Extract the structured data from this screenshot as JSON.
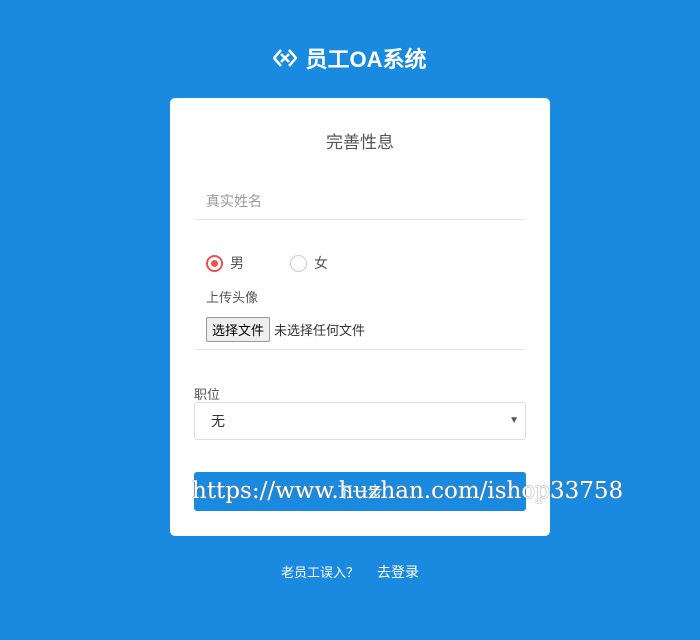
{
  "brand": {
    "title": "员工OA系统",
    "icon": "diamond-links-icon"
  },
  "form": {
    "title": "完善性息",
    "name_placeholder": "真实姓名",
    "gender": {
      "options": [
        "男",
        "女"
      ],
      "selected": "男"
    },
    "avatar_label": "上传头像",
    "file_button": "选择文件",
    "file_status": "未选择任何文件",
    "position_label": "职位",
    "position_value": "无",
    "next_button": "下一步"
  },
  "footer": {
    "prompt": "老员工误入？",
    "login_link": "去登录"
  },
  "watermark": "https://www.huzhan.com/ishop33758",
  "colors": {
    "background": "#1a8ae0",
    "radio": "#f05050"
  }
}
